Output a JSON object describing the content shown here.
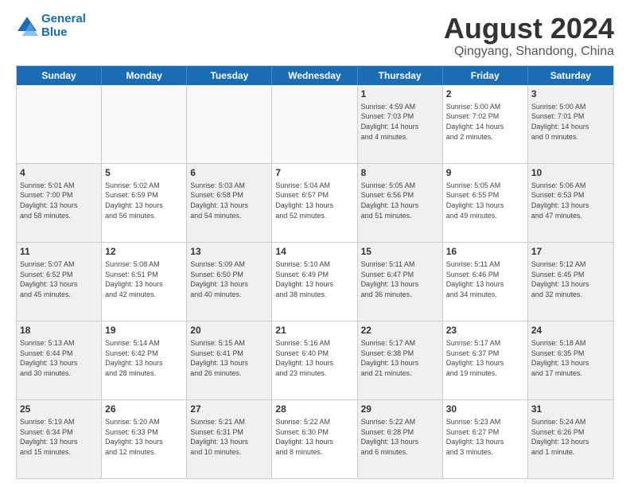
{
  "header": {
    "logo_line1": "General",
    "logo_line2": "Blue",
    "title": "August 2024",
    "subtitle": "Qingyang, Shandong, China"
  },
  "days_of_week": [
    "Sunday",
    "Monday",
    "Tuesday",
    "Wednesday",
    "Thursday",
    "Friday",
    "Saturday"
  ],
  "weeks": [
    [
      {
        "day": "",
        "info": "",
        "empty": true
      },
      {
        "day": "",
        "info": "",
        "empty": true
      },
      {
        "day": "",
        "info": "",
        "empty": true
      },
      {
        "day": "",
        "info": "",
        "empty": true
      },
      {
        "day": "1",
        "info": "Sunrise: 4:59 AM\nSunset: 7:03 PM\nDaylight: 14 hours\nand 4 minutes."
      },
      {
        "day": "2",
        "info": "Sunrise: 5:00 AM\nSunset: 7:02 PM\nDaylight: 14 hours\nand 2 minutes."
      },
      {
        "day": "3",
        "info": "Sunrise: 5:00 AM\nSunset: 7:01 PM\nDaylight: 14 hours\nand 0 minutes."
      }
    ],
    [
      {
        "day": "4",
        "info": "Sunrise: 5:01 AM\nSunset: 7:00 PM\nDaylight: 13 hours\nand 58 minutes."
      },
      {
        "day": "5",
        "info": "Sunrise: 5:02 AM\nSunset: 6:59 PM\nDaylight: 13 hours\nand 56 minutes."
      },
      {
        "day": "6",
        "info": "Sunrise: 5:03 AM\nSunset: 6:58 PM\nDaylight: 13 hours\nand 54 minutes."
      },
      {
        "day": "7",
        "info": "Sunrise: 5:04 AM\nSunset: 6:57 PM\nDaylight: 13 hours\nand 52 minutes."
      },
      {
        "day": "8",
        "info": "Sunrise: 5:05 AM\nSunset: 6:56 PM\nDaylight: 13 hours\nand 51 minutes."
      },
      {
        "day": "9",
        "info": "Sunrise: 5:05 AM\nSunset: 6:55 PM\nDaylight: 13 hours\nand 49 minutes."
      },
      {
        "day": "10",
        "info": "Sunrise: 5:06 AM\nSunset: 6:53 PM\nDaylight: 13 hours\nand 47 minutes."
      }
    ],
    [
      {
        "day": "11",
        "info": "Sunrise: 5:07 AM\nSunset: 6:52 PM\nDaylight: 13 hours\nand 45 minutes."
      },
      {
        "day": "12",
        "info": "Sunrise: 5:08 AM\nSunset: 6:51 PM\nDaylight: 13 hours\nand 42 minutes."
      },
      {
        "day": "13",
        "info": "Sunrise: 5:09 AM\nSunset: 6:50 PM\nDaylight: 13 hours\nand 40 minutes."
      },
      {
        "day": "14",
        "info": "Sunrise: 5:10 AM\nSunset: 6:49 PM\nDaylight: 13 hours\nand 38 minutes."
      },
      {
        "day": "15",
        "info": "Sunrise: 5:11 AM\nSunset: 6:47 PM\nDaylight: 13 hours\nand 36 minutes."
      },
      {
        "day": "16",
        "info": "Sunrise: 5:11 AM\nSunset: 6:46 PM\nDaylight: 13 hours\nand 34 minutes."
      },
      {
        "day": "17",
        "info": "Sunrise: 5:12 AM\nSunset: 6:45 PM\nDaylight: 13 hours\nand 32 minutes."
      }
    ],
    [
      {
        "day": "18",
        "info": "Sunrise: 5:13 AM\nSunset: 6:44 PM\nDaylight: 13 hours\nand 30 minutes."
      },
      {
        "day": "19",
        "info": "Sunrise: 5:14 AM\nSunset: 6:42 PM\nDaylight: 13 hours\nand 28 minutes."
      },
      {
        "day": "20",
        "info": "Sunrise: 5:15 AM\nSunset: 6:41 PM\nDaylight: 13 hours\nand 26 minutes."
      },
      {
        "day": "21",
        "info": "Sunrise: 5:16 AM\nSunset: 6:40 PM\nDaylight: 13 hours\nand 23 minutes."
      },
      {
        "day": "22",
        "info": "Sunrise: 5:17 AM\nSunset: 6:38 PM\nDaylight: 13 hours\nand 21 minutes."
      },
      {
        "day": "23",
        "info": "Sunrise: 5:17 AM\nSunset: 6:37 PM\nDaylight: 13 hours\nand 19 minutes."
      },
      {
        "day": "24",
        "info": "Sunrise: 5:18 AM\nSunset: 6:35 PM\nDaylight: 13 hours\nand 17 minutes."
      }
    ],
    [
      {
        "day": "25",
        "info": "Sunrise: 5:19 AM\nSunset: 6:34 PM\nDaylight: 13 hours\nand 15 minutes."
      },
      {
        "day": "26",
        "info": "Sunrise: 5:20 AM\nSunset: 6:33 PM\nDaylight: 13 hours\nand 12 minutes."
      },
      {
        "day": "27",
        "info": "Sunrise: 5:21 AM\nSunset: 6:31 PM\nDaylight: 13 hours\nand 10 minutes."
      },
      {
        "day": "28",
        "info": "Sunrise: 5:22 AM\nSunset: 6:30 PM\nDaylight: 13 hours\nand 8 minutes."
      },
      {
        "day": "29",
        "info": "Sunrise: 5:22 AM\nSunset: 6:28 PM\nDaylight: 13 hours\nand 6 minutes."
      },
      {
        "day": "30",
        "info": "Sunrise: 5:23 AM\nSunset: 6:27 PM\nDaylight: 13 hours\nand 3 minutes."
      },
      {
        "day": "31",
        "info": "Sunrise: 5:24 AM\nSunset: 6:26 PM\nDaylight: 13 hours\nand 1 minute."
      }
    ]
  ]
}
